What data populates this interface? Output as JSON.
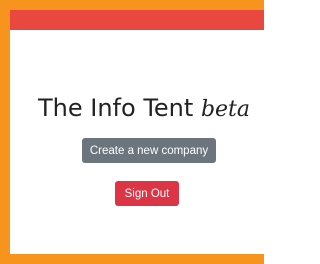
{
  "app": {
    "title": "The Info Tent",
    "title_suffix": "beta"
  },
  "actions": {
    "create_company_label": "Create a new company",
    "sign_out_label": "Sign Out"
  },
  "colors": {
    "frame": "#f7941d",
    "top_bar": "#e8483f",
    "create_button": "#6c757d",
    "sign_out_button": "#dc3545"
  }
}
